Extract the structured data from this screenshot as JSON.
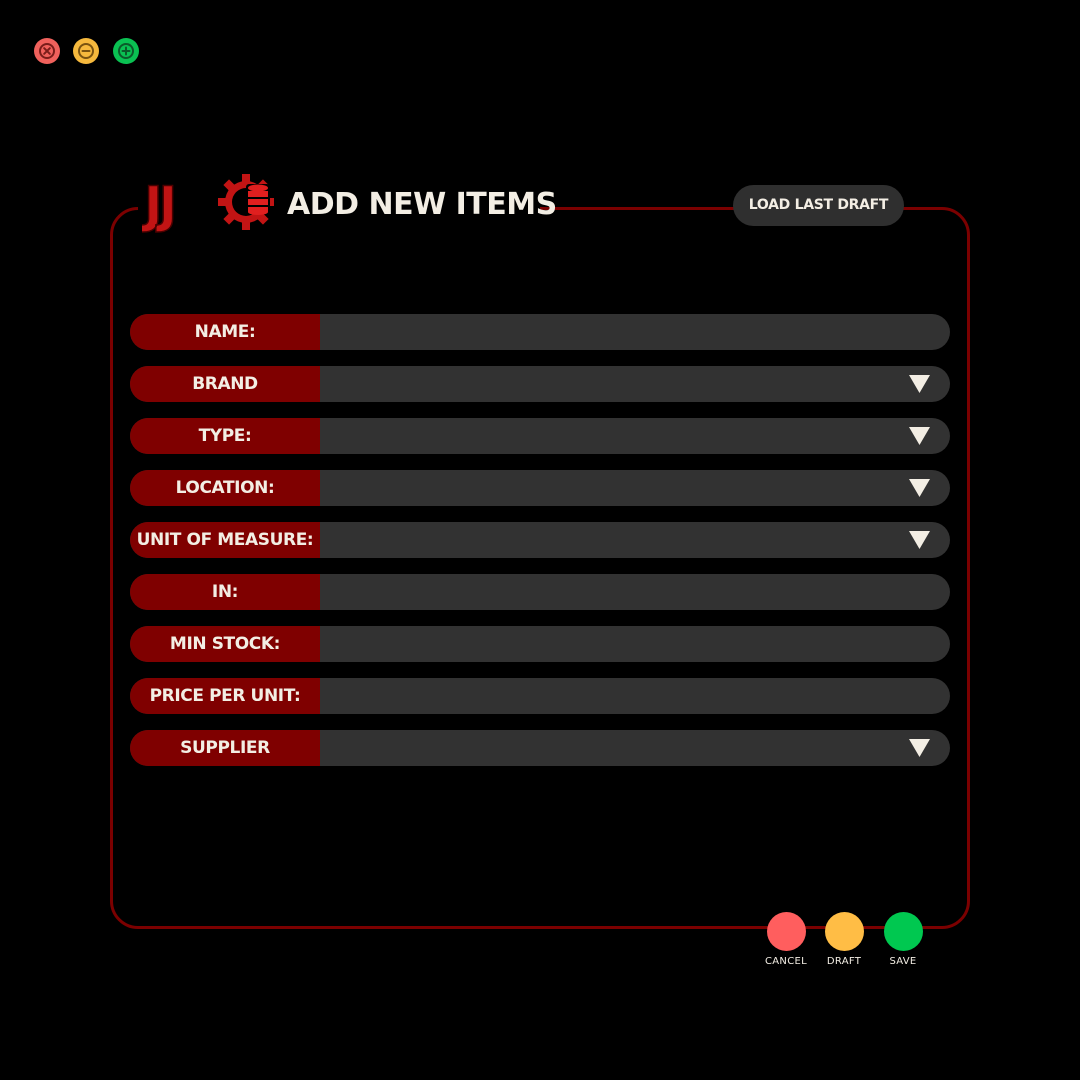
{
  "window_controls": {
    "close_icon": "close-icon",
    "minimize_icon": "minimize-icon",
    "maximize_icon": "maximize-icon",
    "colors": {
      "close": "#f0615c",
      "minimize": "#f6b93d",
      "maximize": "#0ac152"
    }
  },
  "header": {
    "logo_text": "JJ",
    "logo_icon": "gear-database-icon",
    "title": "ADD NEW ITEMS",
    "load_draft_label": "LOAD LAST DRAFT"
  },
  "form": {
    "fields": [
      {
        "label": "NAME:",
        "type": "text",
        "value": ""
      },
      {
        "label": "BRAND",
        "type": "select",
        "value": ""
      },
      {
        "label": "TYPE:",
        "type": "select",
        "value": ""
      },
      {
        "label": "LOCATION:",
        "type": "select",
        "value": ""
      },
      {
        "label": "UNIT OF MEASURE:",
        "type": "select",
        "value": ""
      },
      {
        "label": "IN:",
        "type": "text",
        "value": ""
      },
      {
        "label": "MIN STOCK:",
        "type": "text",
        "value": ""
      },
      {
        "label": "PRICE PER UNIT:",
        "type": "text",
        "value": ""
      },
      {
        "label": "SUPPLIER",
        "type": "select",
        "value": ""
      }
    ]
  },
  "actions": {
    "cancel_label": "CANCEL",
    "draft_label": "DRAFT",
    "save_label": "SAVE"
  },
  "colors": {
    "background": "#000000",
    "accent_red": "#7f0000",
    "field_bg": "#323232",
    "text": "#f3eee4",
    "cancel": "#ff5e5e",
    "draft": "#ffbd45",
    "save": "#00c850"
  }
}
